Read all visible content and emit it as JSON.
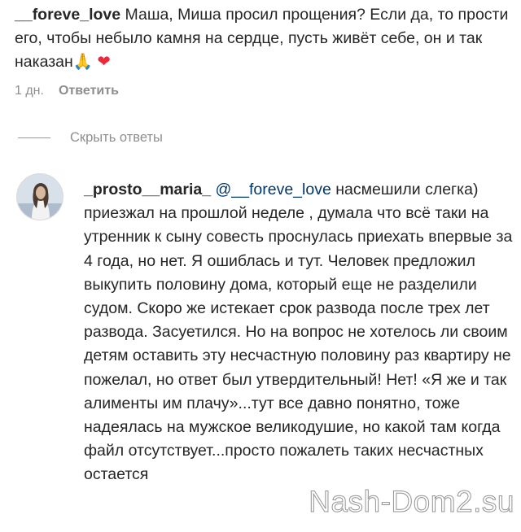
{
  "top_comment": {
    "username": "__foreve_love",
    "text": "Маша, Миша просил прощения? Если да, то прости его, чтобы небыло камня на сердце, пусть живёт себе, он и так наказан",
    "emoji_pray": "🙏",
    "emoji_heart": "❤",
    "time": "1 дн.",
    "reply_label": "Ответить"
  },
  "hide_replies_label": "Скрыть ответы",
  "reply_comment": {
    "username": "_prosto__maria_",
    "mention": "@__foreve_love",
    "text": "насмешили слегка) приезжал на прошлой неделе , думала что всё таки на утренник к сыну совесть проснулась приехать впервые за 4 года, но нет. Я ошиблась и тут. Человек предложил выкупить половину дома, который еще не разделили судом. Скоро же истекает срок развода после трех лет развода. Засуетился. Но на вопрос не хотелось ли своим детям оставить эту несчастную половину раз квартиру не пожелал, но ответ был утвердительный! Нет! «Я же и так алименты им плачу»...тут все давно понятно, тоже надеялась на мужское великодушие, но какой там когда файл отсутствует...просто пожалеть таких несчастных остается"
  },
  "watermark": "Nash-Dom2.su",
  "colors": {
    "text": "#262626",
    "muted": "#8e8e8e",
    "mention": "#00376b",
    "heart": "#ed2939"
  }
}
